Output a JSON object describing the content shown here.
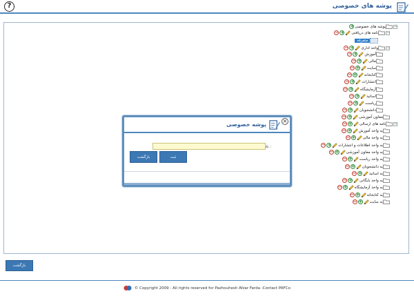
{
  "header": {
    "title": "پوشه های خصوصی",
    "help_label": "?"
  },
  "tree": {
    "items": [
      {
        "label": "پوشه های خصوصی"
      },
      {
        "label": "نامه های دریافتی"
      },
      {
        "label": "متفرقه"
      },
      {
        "label": "واحد اداری"
      },
      {
        "label": "آموزش"
      },
      {
        "label": "مالی"
      },
      {
        "label": "سایت"
      },
      {
        "label": "کتابخانه"
      },
      {
        "label": "انتشارات"
      },
      {
        "label": "آزمایشگاه"
      },
      {
        "label": "اساتید"
      },
      {
        "label": "ریاست"
      },
      {
        "label": "دانشجویان"
      },
      {
        "label": "معاون آموزشی"
      },
      {
        "label": "نامه های ارسالی"
      },
      {
        "label": "به واحد آموزش"
      },
      {
        "label": "به واحد مالی"
      },
      {
        "label": "به واحد اطلاعات و انتشارات"
      },
      {
        "label": "به واحد معاون آموزشی"
      },
      {
        "label": "به واحد ریاست"
      },
      {
        "label": "به دانشجویان"
      },
      {
        "label": "به اساتید"
      },
      {
        "label": "به واحد بایگانی"
      },
      {
        "label": "به واحد آزمایشگاه"
      },
      {
        "label": "به کتابخانه"
      },
      {
        "label": "به سایت"
      }
    ]
  },
  "modal": {
    "title": "پوشه خصوصی",
    "field_label": "نام پوشه :",
    "field_value": "",
    "submit_label": "ثبت",
    "back_label": "بازگشت",
    "close_label": "×"
  },
  "bottom": {
    "back_label": "بازگشت"
  },
  "footer": {
    "copyright": "© Copyright 2009 - All rights reserved for Pazhouhesh Afzar Farda -Contact PAFCo"
  },
  "colors": {
    "accent": "#2f7fc9",
    "button_bg": "#3c78b4",
    "header_line": "#4c86bf"
  }
}
